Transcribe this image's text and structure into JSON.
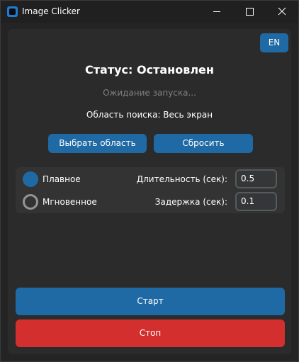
{
  "window": {
    "title": "Image Clicker",
    "minimize_icon": "minimize-icon",
    "maximize_icon": "maximize-icon",
    "close_icon": "close-icon"
  },
  "header": {
    "lang_label": "EN"
  },
  "status": {
    "title": "Статус: Остановлен",
    "subtitle": "Ожидание запуска...",
    "area": "Область поиска: Весь экран"
  },
  "area_buttons": {
    "select_label": "Выбрать область",
    "reset_label": "Сбросить"
  },
  "options": {
    "mode_smooth_label": "Плавное",
    "mode_instant_label": "Мгновенное",
    "selected_mode": "Плавное",
    "duration_label": "Длительность (сек):",
    "duration_value": "0.5",
    "delay_label": "Задержка (сек):",
    "delay_value": "0.1"
  },
  "controls": {
    "start_label": "Старт",
    "stop_label": "Стоп"
  },
  "colors": {
    "accent": "#1f6aa5",
    "danger": "#d32f2f",
    "background": "#242424",
    "panel": "#2b2b2b"
  }
}
